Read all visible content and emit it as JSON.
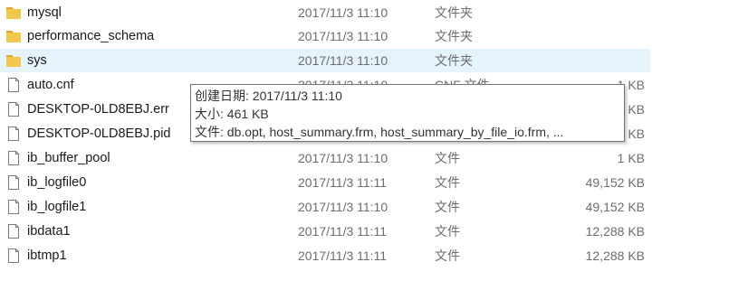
{
  "files": [
    {
      "name": "mysql",
      "date": "2017/11/3 11:10",
      "type": "文件夹",
      "size": "",
      "icon": "folder-icon"
    },
    {
      "name": "performance_schema",
      "date": "2017/11/3 11:10",
      "type": "文件夹",
      "size": "",
      "icon": "folder-icon"
    },
    {
      "name": "sys",
      "date": "2017/11/3 11:10",
      "type": "文件夹",
      "size": "",
      "icon": "folder-icon",
      "selected": true
    },
    {
      "name": "auto.cnf",
      "date": "2017/11/3 11:10",
      "type": "CNF 文件",
      "size": "1 KB",
      "icon": "file-icon"
    },
    {
      "name": "DESKTOP-0LD8EBJ.err",
      "date": "",
      "type": "",
      "size": "KB",
      "icon": "file-icon"
    },
    {
      "name": "DESKTOP-0LD8EBJ.pid",
      "date": "",
      "type": "",
      "size": "KB",
      "icon": "file-icon"
    },
    {
      "name": "ib_buffer_pool",
      "date": "2017/11/3 11:10",
      "type": "文件",
      "size": "1 KB",
      "icon": "file-icon"
    },
    {
      "name": "ib_logfile0",
      "date": "2017/11/3 11:11",
      "type": "文件",
      "size": "49,152 KB",
      "icon": "file-icon"
    },
    {
      "name": "ib_logfile1",
      "date": "2017/11/3 11:10",
      "type": "文件",
      "size": "49,152 KB",
      "icon": "file-icon"
    },
    {
      "name": "ibdata1",
      "date": "2017/11/3 11:11",
      "type": "文件",
      "size": "12,288 KB",
      "icon": "file-icon"
    },
    {
      "name": "ibtmp1",
      "date": "2017/11/3 11:11",
      "type": "文件",
      "size": "12,288 KB",
      "icon": "file-icon"
    }
  ],
  "tooltip": {
    "created": "创建日期: 2017/11/3 11:10",
    "size": "大小: 461 KB",
    "files": "文件: db.opt, host_summary.frm, host_summary_by_file_io.frm, ..."
  },
  "colors": {
    "folder": "#f2c84b",
    "folder_dark": "#dca92e",
    "selection": "#e5f3fb"
  }
}
